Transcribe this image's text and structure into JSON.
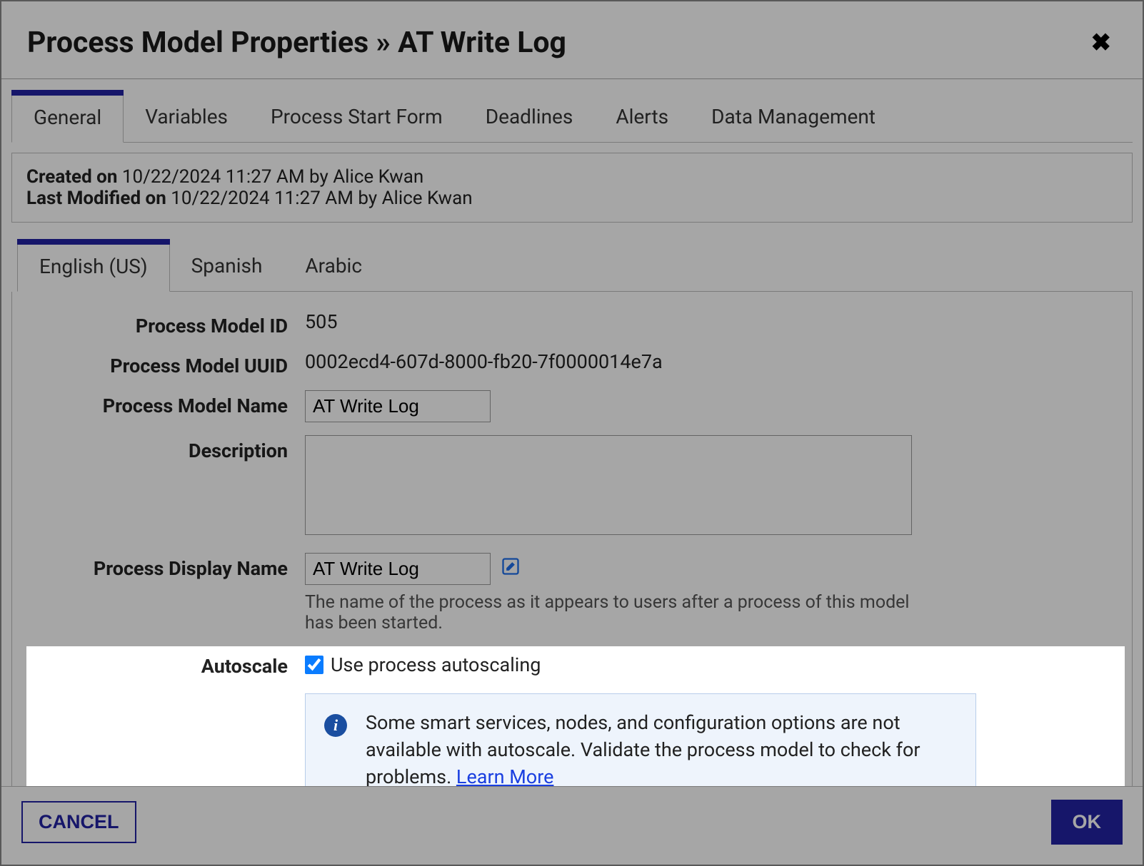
{
  "dialog": {
    "title": "Process Model Properties » AT Write Log"
  },
  "tabs": {
    "items": [
      {
        "label": "General"
      },
      {
        "label": "Variables"
      },
      {
        "label": "Process Start Form"
      },
      {
        "label": "Deadlines"
      },
      {
        "label": "Alerts"
      },
      {
        "label": "Data Management"
      }
    ],
    "active_index": 0
  },
  "meta": {
    "created_label": "Created on",
    "created_value": "10/22/2024 11:27 AM by Alice Kwan",
    "modified_label": "Last Modified on",
    "modified_value": "10/22/2024 11:27 AM by Alice Kwan"
  },
  "langs": {
    "items": [
      {
        "label": "English (US)"
      },
      {
        "label": "Spanish"
      },
      {
        "label": "Arabic"
      }
    ],
    "active_index": 0
  },
  "form": {
    "id_label": "Process Model ID",
    "id_value": "505",
    "uuid_label": "Process Model UUID",
    "uuid_value": "0002ecd4-607d-8000-fb20-7f0000014e7a",
    "name_label": "Process Model Name",
    "name_value": "AT Write Log",
    "description_label": "Description",
    "description_value": "",
    "display_label": "Process Display Name",
    "display_value": "AT Write Log",
    "display_help": "The name of the process as it appears to users after a process of this model has been started.",
    "autoscale_label": "Autoscale",
    "autoscale_check_label": "Use process autoscaling",
    "autoscale_checked": true,
    "autoscale_info": "Some smart services, nodes, and configuration options are not available with autoscale. Validate the process model to check for problems. ",
    "autoscale_learn_more": "Learn More"
  },
  "footer": {
    "cancel": "CANCEL",
    "ok": "OK"
  }
}
